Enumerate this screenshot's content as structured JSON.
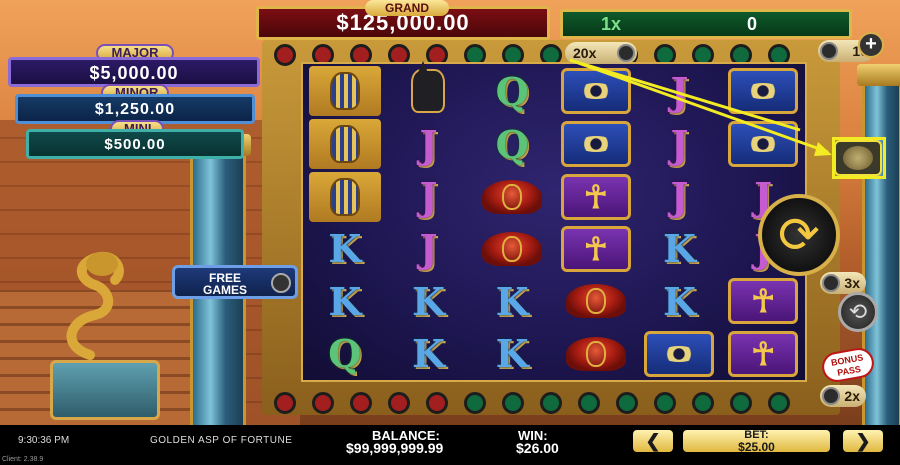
{
  "jackpots": {
    "grand_label": "GRAND",
    "grand_value": "$125,000.00",
    "major_label": "MAJOR",
    "major_value": "$5,000.00",
    "minor_label": "MINOR",
    "minor_value": "$1,250.00",
    "mini_label": "MINI",
    "mini_value": "$500.00"
  },
  "multiplier_bar": {
    "label": "1x",
    "value": "0"
  },
  "side_multipliers": {
    "top": "20x",
    "top_right": "10",
    "mid_right": "3x",
    "bottom_right": "2x"
  },
  "buttons": {
    "free_games_line1": "FREE",
    "free_games_line2": "GAMES",
    "bonus_pass_line1": "BONUS",
    "bonus_pass_line2": "PASS",
    "plus": "+",
    "spin_icon": "refresh-icon",
    "autoplay_icon": "autoplay-icon"
  },
  "reels": [
    [
      "pharaoh",
      "anubis",
      "Q",
      "eye",
      "J",
      "eye"
    ],
    [
      "pharaoh",
      "J",
      "Q",
      "eye",
      "J",
      "eye"
    ],
    [
      "pharaoh",
      "J",
      "scarab",
      "ankh",
      "J",
      "J"
    ],
    [
      "K",
      "J",
      "scarab",
      "ankh",
      "K",
      "J"
    ],
    [
      "K",
      "K",
      "K",
      "scarab",
      "K",
      "ankh"
    ],
    [
      "Q",
      "K",
      "K",
      "scarab",
      "eye",
      "ankh"
    ]
  ],
  "status_bar": {
    "time": "9:30:36 PM",
    "game_title": "GOLDEN ASP OF FORTUNE",
    "client_version": "Client: 2.38.9",
    "balance_label": "BALANCE:",
    "balance_value": "$99,999,999.99",
    "win_label": "WIN:",
    "win_value": "$26.00",
    "bet_label": "BET:",
    "bet_value": "$25.00",
    "bet_decrease": "❮",
    "bet_increase": "❯"
  },
  "colors": {
    "grand_bg": "#7b0e13",
    "mult_bg": "#0e5a2a",
    "gold": "#e0b64a",
    "annotation_yellow": "#f3ec22"
  }
}
